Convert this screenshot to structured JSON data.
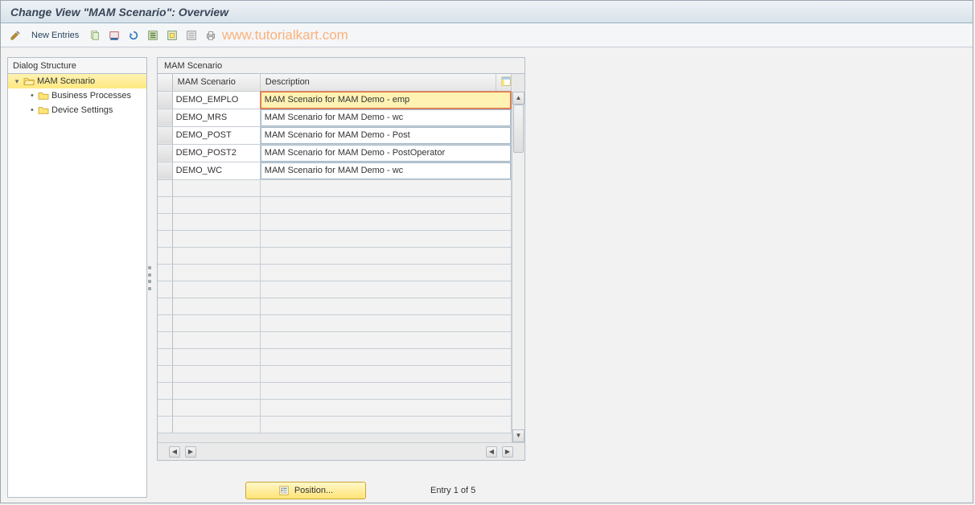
{
  "title": "Change View \"MAM Scenario\": Overview",
  "toolbar": {
    "new_entries": "New Entries"
  },
  "watermark": "www.tutorialkart.com",
  "tree": {
    "header": "Dialog Structure",
    "root": "MAM Scenario",
    "children": [
      "Business Processes",
      "Device Settings"
    ]
  },
  "grid": {
    "title": "MAM Scenario",
    "columns": [
      "MAM Scenario",
      "Description"
    ],
    "rows": [
      {
        "scenario": "DEMO_EMPLO",
        "description": "MAM Scenario for MAM Demo - emp",
        "selected": true
      },
      {
        "scenario": "DEMO_MRS",
        "description": "MAM Scenario for MAM Demo - wc"
      },
      {
        "scenario": "DEMO_POST",
        "description": "MAM Scenario for MAM Demo - Post"
      },
      {
        "scenario": "DEMO_POST2",
        "description": "MAM Scenario for MAM Demo - PostOperator"
      },
      {
        "scenario": "DEMO_WC",
        "description": "MAM Scenario for MAM Demo - wc"
      }
    ]
  },
  "footer": {
    "position_label": "Position...",
    "entry_text": "Entry 1 of 5"
  }
}
